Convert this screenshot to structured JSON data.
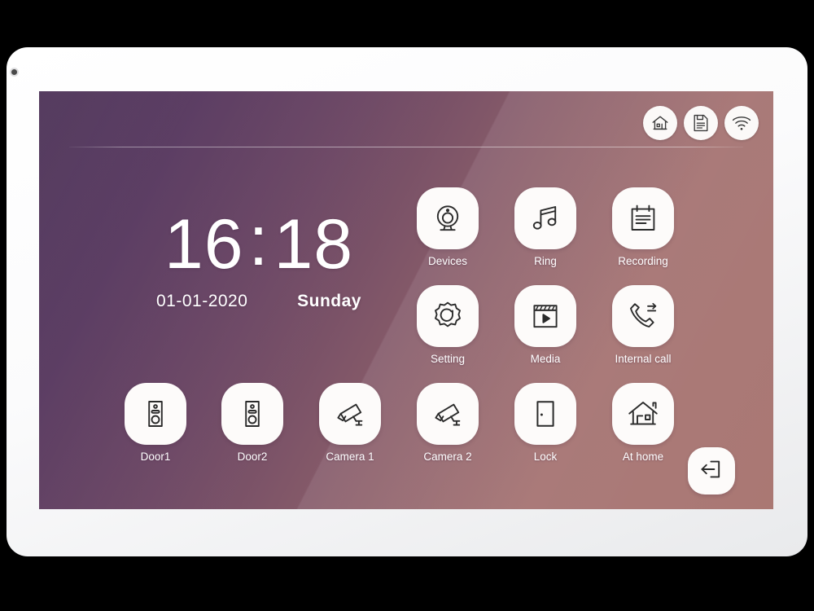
{
  "device": {
    "type": "video-intercom-indoor-monitor",
    "bezel_color": "#ffffff",
    "screen_gradient_from": "#4c3257",
    "screen_gradient_to": "#a5706b"
  },
  "status_bar": {
    "icons": [
      {
        "name": "home-icon",
        "label": "Home"
      },
      {
        "name": "sd-card-icon",
        "label": "Storage"
      },
      {
        "name": "wifi-icon",
        "label": "Wi-Fi"
      }
    ]
  },
  "clock": {
    "hours": "16",
    "colon": ":",
    "minutes": "18",
    "date": "01-01-2020",
    "weekday": "Sunday"
  },
  "apps": {
    "row1": [
      {
        "label": "Devices",
        "icon": "webcam-icon"
      },
      {
        "label": "Ring",
        "icon": "music-note-icon"
      },
      {
        "label": "Recording",
        "icon": "notepad-icon"
      }
    ],
    "row2": [
      {
        "label": "Setting",
        "icon": "gear-icon"
      },
      {
        "label": "Media",
        "icon": "clapperboard-play-icon"
      },
      {
        "label": "Internal call",
        "icon": "phone-transfer-icon"
      }
    ],
    "row3": [
      {
        "label": "Door1",
        "icon": "doorbell-panel-icon"
      },
      {
        "label": "Door2",
        "icon": "doorbell-panel-icon"
      },
      {
        "label": "Camera 1",
        "icon": "cctv-camera-icon"
      },
      {
        "label": "Camera 2",
        "icon": "cctv-camera-icon"
      },
      {
        "label": "Lock",
        "icon": "door-icon"
      },
      {
        "label": "At home",
        "icon": "house-icon"
      }
    ]
  },
  "exit_button": {
    "label": "Exit",
    "icon": "exit-arrow-icon"
  }
}
